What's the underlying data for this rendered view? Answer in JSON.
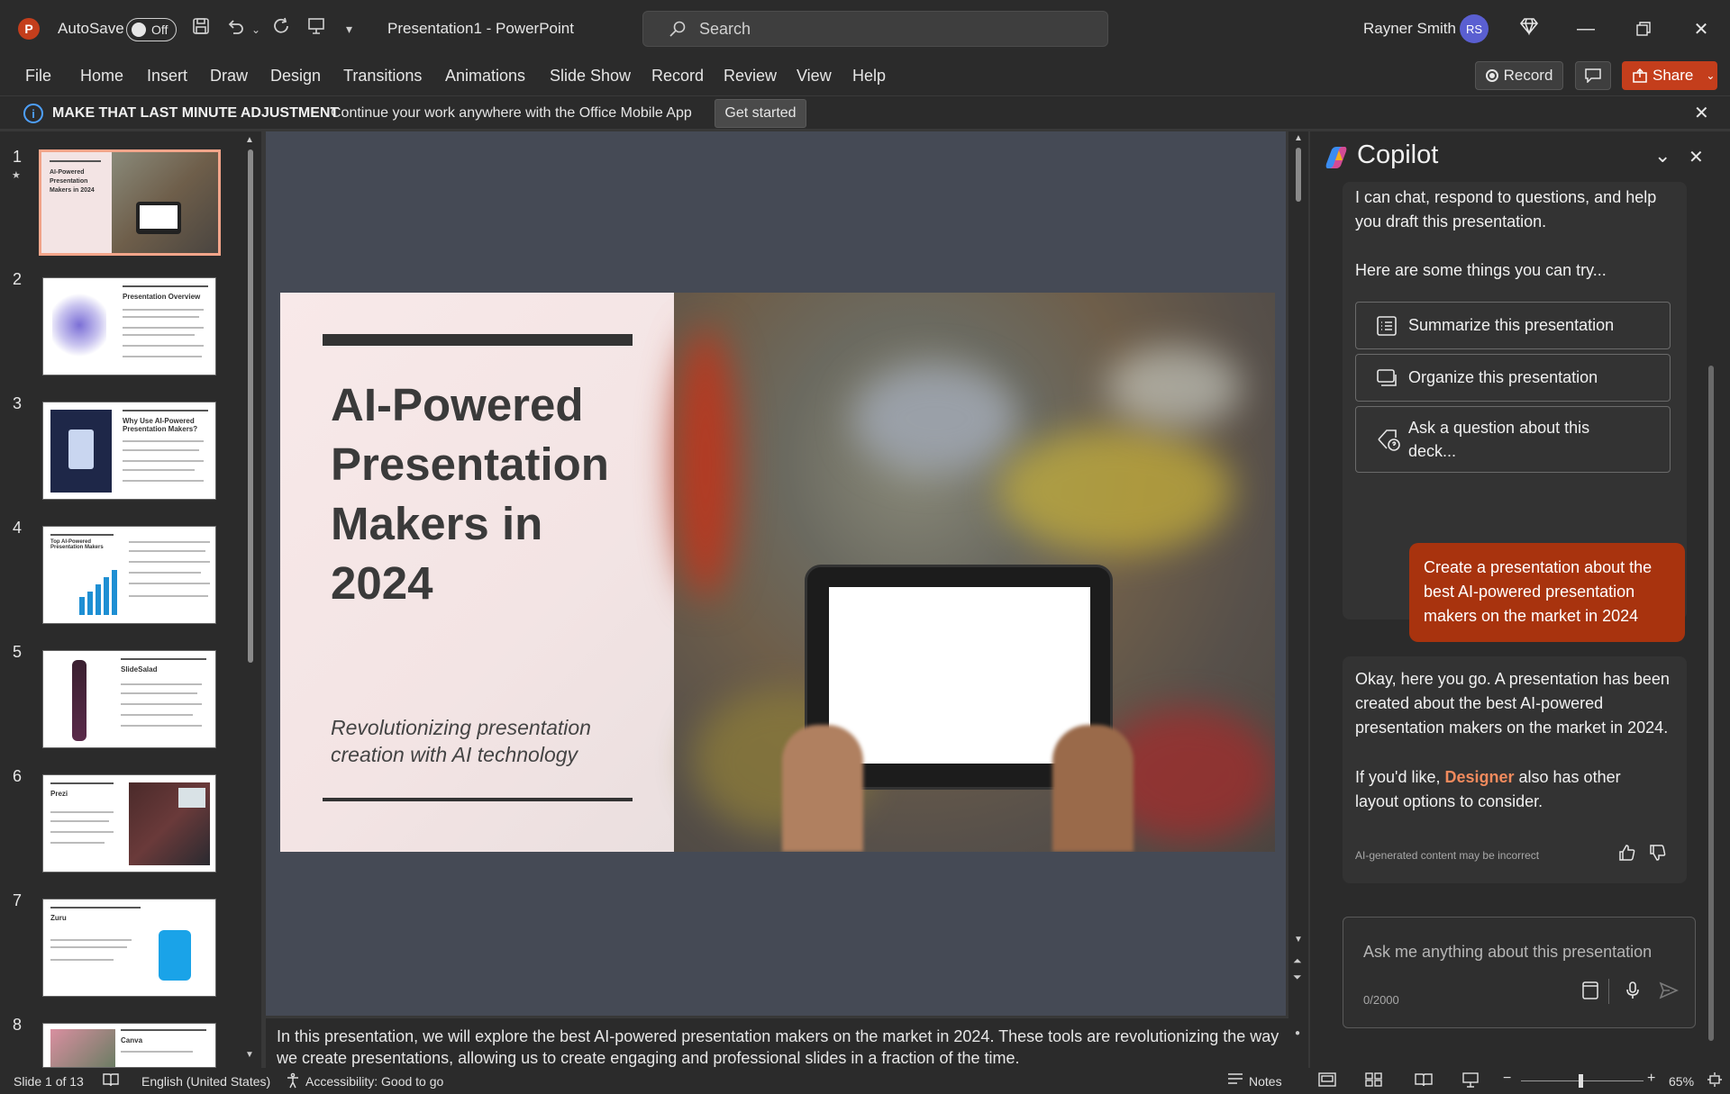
{
  "app": {
    "autosave_label": "AutoSave",
    "autosave_state": "Off",
    "doc_title": "Presentation1 - PowerPoint",
    "search_placeholder": "Search",
    "user_name": "Rayner Smith",
    "user_initials": "RS"
  },
  "menu": [
    "File",
    "Home",
    "Insert",
    "Draw",
    "Design",
    "Transitions",
    "Animations",
    "Slide Show",
    "Record",
    "Review",
    "View",
    "Help"
  ],
  "toolbar": {
    "record_label": "Record",
    "share_label": "Share"
  },
  "infobar": {
    "title": "MAKE THAT LAST MINUTE ADJUSTMENT",
    "message": "Continue your work anywhere with the Office Mobile App",
    "button": "Get started"
  },
  "thumbnails": [
    {
      "num": "1",
      "title": "AI-Powered Presentation Makers in 2024"
    },
    {
      "num": "2",
      "title": "Presentation Overview"
    },
    {
      "num": "3",
      "title": "Why Use AI-Powered Presentation Makers?"
    },
    {
      "num": "4",
      "title": "Top AI-Powered Presentation Makers"
    },
    {
      "num": "5",
      "title": "SlideSalad"
    },
    {
      "num": "6",
      "title": "Prezi"
    },
    {
      "num": "7",
      "title": "Zuru"
    },
    {
      "num": "8",
      "title": "Canva"
    }
  ],
  "slide": {
    "title": "AI-Powered Presentation Makers in 2024",
    "subtitle": "Revolutionizing presentation creation with AI technology"
  },
  "notes": "In this presentation, we will explore the best AI-powered presentation makers on the market in 2024. These tools are revolutionizing the way we create presentations, allowing us to create engaging and professional slides in a fraction of the time.",
  "copilot": {
    "title": "Copilot",
    "intro": "I can chat, respond to questions, and help you draft this presentation.",
    "try_label": "Here are some things you can try...",
    "suggestions": [
      "Summarize this presentation",
      "Organize this presentation",
      "Ask a question about this deck..."
    ],
    "user_message": "Create a presentation about the best AI-powered presentation makers on the market in 2024",
    "ai_response": "Okay, here you go. A presentation has been created about the best AI-powered presentation makers on the market in 2024.",
    "ai_followup_pre": "If you'd like, ",
    "ai_followup_link": "Designer",
    "ai_followup_post": " also has other layout options to consider.",
    "disclaimer": "AI-generated content may be incorrect",
    "input_placeholder": "Ask me anything about this presentation",
    "char_count": "0/2000"
  },
  "status": {
    "slide_info": "Slide 1 of 13",
    "language": "English (United States)",
    "accessibility": "Accessibility: Good to go",
    "notes_label": "Notes",
    "zoom": "65%"
  }
}
